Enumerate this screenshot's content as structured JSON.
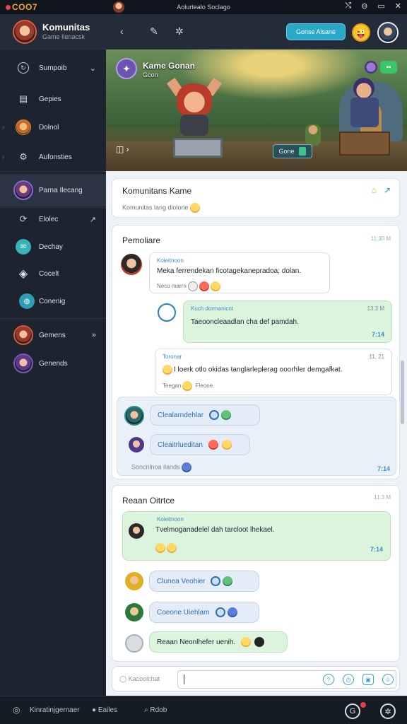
{
  "titlebar": {
    "logo": "COO7",
    "title": "Aolurtealo Soclago",
    "controls": [
      "⤭",
      "⊖",
      "▭",
      "✕"
    ]
  },
  "header": {
    "user_name": "Komunitas",
    "user_sub": "Game Ilenacsk",
    "primary_button": "Gonse Alsane",
    "emoji": "😜"
  },
  "sidebar": {
    "items": [
      {
        "label": "Sumpoib",
        "icon": "refresh-icon",
        "glyph": "↻"
      },
      {
        "label": "Gepies",
        "icon": "folder-icon",
        "glyph": "▤"
      },
      {
        "label": "Dolnol",
        "icon": "game-avatar-icon",
        "glyph": ""
      },
      {
        "label": "Aufonsties",
        "icon": "settings-icon",
        "glyph": "⚙"
      },
      {
        "label": "Parna Ilecang",
        "icon": "profile-avatar",
        "glyph": ""
      },
      {
        "label": "Elolec",
        "icon": "sync-icon",
        "glyph": "⟳"
      },
      {
        "label": "Dechay",
        "icon": "chat-icon",
        "glyph": "◉"
      },
      {
        "label": "Cocelt",
        "icon": "controller-icon",
        "glyph": "◈"
      },
      {
        "label": "Conenig",
        "icon": "shield-icon",
        "glyph": "◍"
      },
      {
        "label": "Gemens",
        "icon": "hero-avatar",
        "glyph": ""
      },
      {
        "label": "Genends",
        "icon": "warrior-avatar",
        "glyph": ""
      }
    ]
  },
  "banner": {
    "title": "Kame Gonan",
    "subtitle": "Gcon",
    "play_label": "Gorie",
    "nav_glyph": "◫ ›"
  },
  "community_card": {
    "title": "Komunitans Kame",
    "subtitle": "Komunitas lang diolorie",
    "emoji": "😜"
  },
  "section1": {
    "title": "Pemoliare",
    "time": "11:30 M",
    "msg1": {
      "sender": "Koieitnoon",
      "text": "Meka ferrendekan ficotagekanepradoa; dolan.",
      "meta": "Neco marrn"
    },
    "msg2": {
      "sender": "Kuch dormanicnt",
      "time": "13.3 M",
      "text": "Taeooncleaadlan cha def pamdah.",
      "check": "7:14"
    },
    "msg3": {
      "sender": "Toronar",
      "time": "11, 21",
      "text": "I loerk otlo okidas tanglarleplerag ooorhler demgafkat.",
      "meta": "Teegan",
      "meta2": "Fleooe."
    },
    "thread": {
      "reply1": "Clealarndehlar",
      "reply2": "Cleaitrlueditan",
      "footer": "Soncnlnoa ilands",
      "check": "7:14"
    }
  },
  "section2": {
    "title": "Reaan Oitrtce",
    "time": "11:3 M",
    "msg1": {
      "sender": "Koieitnoon",
      "text": "Tvelmoganadelel dah tarcloot lhekael.",
      "check": "7:14"
    },
    "replies": [
      "Clunea Veohier",
      "Coeone Uiehlam",
      "Reaan Neonlhefer uenih."
    ]
  },
  "input": {
    "label": "Kacoolchat",
    "value": ""
  },
  "footer": {
    "left_label": "Kinratinjgernaer",
    "mid_label": "Eailes",
    "search_label": "Rdob"
  },
  "colors": {
    "accent": "#2aa8c8",
    "sidebar_bg": "#1d2430",
    "bubble_green": "#dcf3dc",
    "bubble_blue": "#e6eef8"
  }
}
